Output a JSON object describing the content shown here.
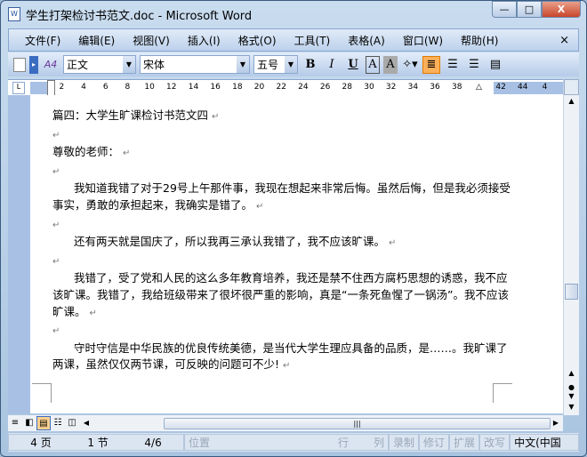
{
  "window": {
    "title": "学生打架检讨书范文.doc - Microsoft Word",
    "app_icon": "W",
    "min": "—",
    "max": "□",
    "close": "X"
  },
  "menu": [
    "文件(F)",
    "编辑(E)",
    "视图(V)",
    "插入(I)",
    "格式(O)",
    "工具(T)",
    "表格(A)",
    "窗口(W)",
    "帮助(H)"
  ],
  "menu_close": "×",
  "toolbar": {
    "style": "正文",
    "font": "宋体",
    "size": "五号",
    "bold": "B",
    "italic": "I",
    "underline": "U",
    "border_a": "A",
    "shade_a": "A",
    "styles_icon": "A4"
  },
  "ruler": {
    "numbers": [
      "2",
      "4",
      "6",
      "8",
      "10",
      "12",
      "14",
      "16",
      "18",
      "20",
      "22",
      "24",
      "26",
      "28",
      "30",
      "32",
      "34",
      "36",
      "38",
      "",
      "42",
      "44",
      "4"
    ]
  },
  "document": {
    "paragraphs": [
      {
        "text": "篇四：大学生旷课检讨书范文四",
        "indent": false
      },
      {
        "text": "",
        "indent": false
      },
      {
        "text": "尊敬的老师：",
        "indent": false
      },
      {
        "text": "",
        "indent": false
      },
      {
        "text": "我知道我错了对于29号上午那件事，我现在想起来非常后悔。虽然后悔，但是我必须接受事实，勇敢的承担起来，我确实是错了。",
        "indent": true
      },
      {
        "text": "",
        "indent": false
      },
      {
        "text": "还有两天就是国庆了，所以我再三承认我错了，我不应该旷课。",
        "indent": true
      },
      {
        "text": "",
        "indent": false
      },
      {
        "text": "我错了，受了党和人民的这么多年教育培养，我还是禁不住西方腐朽思想的诱惑，我不应该旷课。我错了，我给班级带来了很坏很严重的影响，真是“一条死鱼惺了一锅汤”。我不应该旷课。",
        "indent": true
      },
      {
        "text": "",
        "indent": false
      },
      {
        "text": "守时守信是中华民族的优良传统美德，是当代大学生理应具备的品质，是……。我旷课了两课，虽然仅仅两节课，可反映的问题可不少!",
        "indent": true
      }
    ],
    "paragraph_mark": "↵"
  },
  "status": {
    "page": "4 页",
    "section": "1 节",
    "pages": "4/6",
    "position": "位置",
    "line": "行",
    "col": "列",
    "rec": "录制",
    "trk": "修订",
    "ext": "扩展",
    "ovr": "改写",
    "lang": "中文(中国"
  }
}
